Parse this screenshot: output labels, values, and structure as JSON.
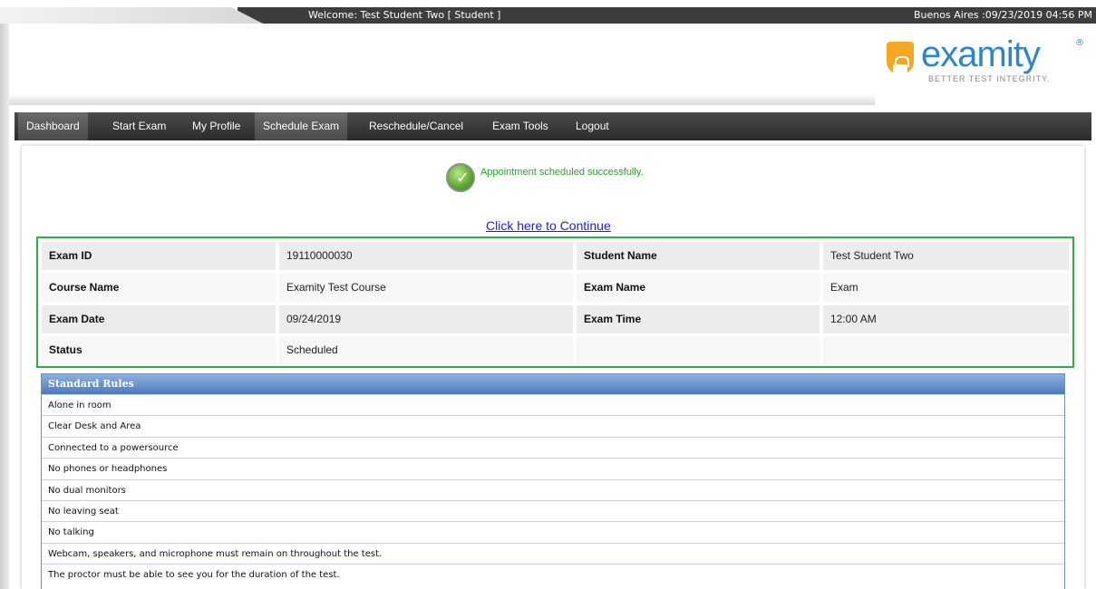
{
  "topbar": {
    "welcome": "Welcome: Test Student Two [ Student ]",
    "datetime": "Buenos Aires :09/23/2019 04:56 PM"
  },
  "logo": {
    "name": "examity",
    "tagline": "BETTER TEST INTEGRITY."
  },
  "nav": {
    "items": [
      {
        "label": "Dashboard"
      },
      {
        "label": "Start Exam"
      },
      {
        "label": "My Profile"
      },
      {
        "label": "Schedule Exam"
      },
      {
        "label": "Reschedule/Cancel"
      },
      {
        "label": "Exam Tools"
      },
      {
        "label": "Logout"
      }
    ]
  },
  "status": {
    "message": "Appointment scheduled successfully.",
    "continue_link": "Click here to Continue"
  },
  "exam_details": [
    {
      "label1": "Exam ID",
      "value1": "19110000030",
      "label2": "Student Name",
      "value2": "Test Student Two"
    },
    {
      "label1": "Course Name",
      "value1": "Examity Test Course",
      "label2": "Exam Name",
      "value2": "Exam"
    },
    {
      "label1": "Exam Date",
      "value1": "09/24/2019",
      "label2": "Exam Time",
      "value2": "12:00 AM"
    },
    {
      "label1": "Status",
      "value1": "Scheduled",
      "label2": "",
      "value2": ""
    }
  ],
  "rules": {
    "title": "Standard Rules",
    "items": [
      "Alone in room",
      "Clear Desk and Area",
      "Connected to a powersource",
      "No phones or headphones",
      "No dual monitors",
      "No leaving seat",
      "No talking",
      "Webcam, speakers, and microphone must remain on throughout the test.",
      "The proctor must be able to see you for the duration of the test."
    ]
  },
  "colors": {
    "nav_bg": "#3a3a3a",
    "success_green": "#2aa12a",
    "details_border": "#2fae45",
    "link_blue": "#1a1aee",
    "rules_header": "#5a84c2",
    "logo_blue": "#2e86c6",
    "logo_orange": "#f5a623"
  }
}
